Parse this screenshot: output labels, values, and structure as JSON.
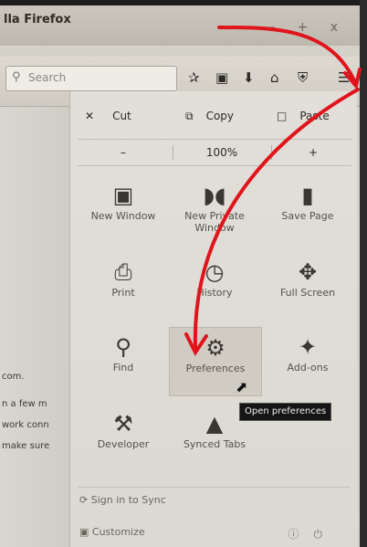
{
  "window": {
    "title": "lla Firefox",
    "controls": "– + x"
  },
  "toolbar": {
    "search_placeholder": "Search",
    "icons": [
      "star-icon",
      "clipboard-icon",
      "download-icon",
      "home-icon",
      "shield-icon",
      "menu-icon"
    ]
  },
  "page": {
    "lines": [
      "com.",
      "n a few m",
      "work conn",
      "make sure"
    ]
  },
  "menu": {
    "edit": {
      "cut": "Cut",
      "copy": "Copy",
      "paste": "Paste"
    },
    "zoom": {
      "minus": "–",
      "level": "100%",
      "plus": "+"
    },
    "items": [
      {
        "label": "New Window",
        "icon": "new-window-icon"
      },
      {
        "label": "New Private Window",
        "icon": "private-mask-icon"
      },
      {
        "label": "Save Page",
        "icon": "save-page-icon"
      },
      {
        "label": "Print",
        "icon": "print-icon"
      },
      {
        "label": "History",
        "icon": "history-icon"
      },
      {
        "label": "Full Screen",
        "icon": "fullscreen-icon"
      },
      {
        "label": "Find",
        "icon": "find-icon"
      },
      {
        "label": "Preferences",
        "icon": "gear-icon"
      },
      {
        "label": "Add-ons",
        "icon": "puzzle-icon"
      },
      {
        "label": "Developer",
        "icon": "wrench-icon"
      },
      {
        "label": "Synced Tabs",
        "icon": "synced-tabs-icon"
      }
    ],
    "sign_in": "Sign in to Sync",
    "customize": "Customize",
    "tooltip": "Open preferences"
  },
  "colors": {
    "arrow": "#e0141c",
    "tooltip_bg": "#151515"
  }
}
